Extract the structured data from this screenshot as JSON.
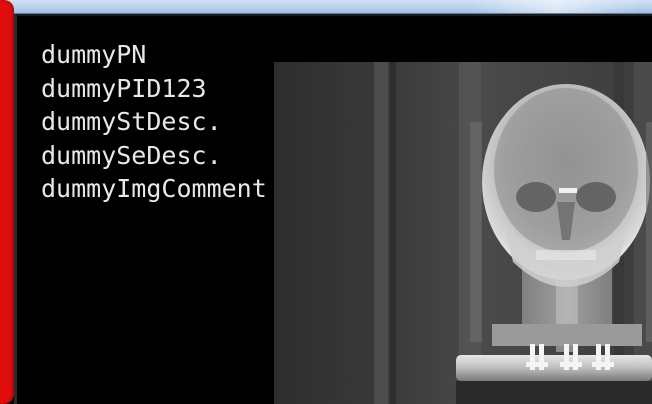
{
  "overlay": {
    "lines": [
      "dummyPN",
      "dummyPID123",
      "dummyStDesc.",
      "dummySeDesc.",
      "dummyImgComment"
    ]
  },
  "colors": {
    "background": "#000000",
    "overlay_text": "#e8e8e8",
    "left_bar": "#e00d0d",
    "title_strip": "#b8d0ea"
  },
  "icons": {
    "image": "xray-skull-image"
  }
}
